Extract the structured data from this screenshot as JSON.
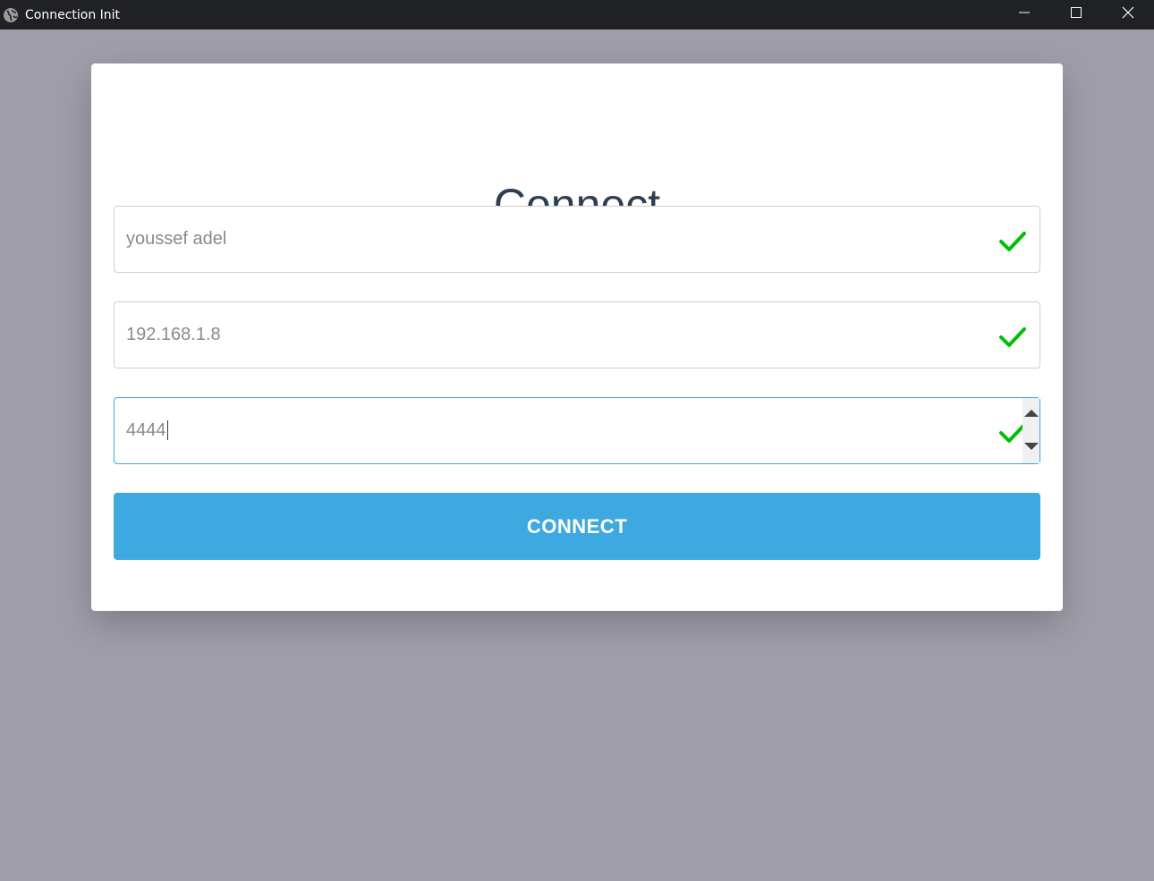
{
  "window": {
    "title": "Connection Init",
    "icon": "globe-icon",
    "controls": [
      "minimize-icon",
      "maximize-icon",
      "close-icon"
    ]
  },
  "form": {
    "title": "Connect",
    "fields": [
      {
        "name": "username",
        "value": "youssef adel",
        "valid": true,
        "icon": "check-icon"
      },
      {
        "name": "ip",
        "value": "192.168.1.8",
        "valid": true,
        "icon": "check-icon"
      },
      {
        "name": "port",
        "value": "4444",
        "valid": true,
        "icon": "check-icon",
        "focused": true
      }
    ],
    "submit_label": "CONNECT"
  },
  "colors": {
    "accent": "#3ea9e0",
    "valid": "#00c000",
    "backdrop": "#a09fa9",
    "titlebar": "#202125",
    "heading": "#2c3e50"
  }
}
